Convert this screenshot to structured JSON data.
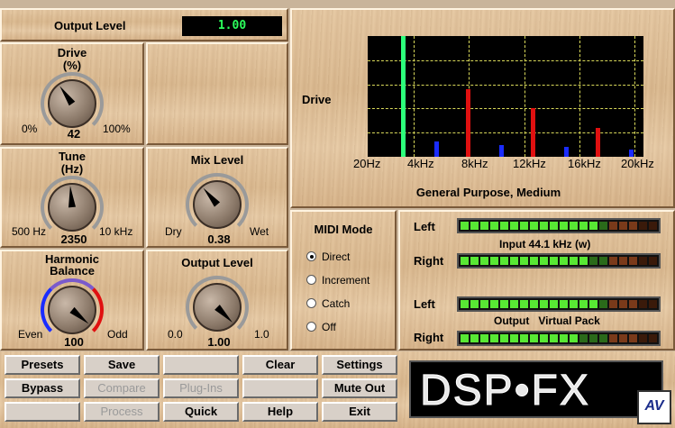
{
  "header": {
    "output_level_label": "Output Level",
    "output_level_value": "1.00"
  },
  "knobs": {
    "drive": {
      "title": "Drive",
      "unit": "(%)",
      "min": "0%",
      "max": "100%",
      "value": "42"
    },
    "tune": {
      "title": "Tune",
      "unit": "(Hz)",
      "min": "500 Hz",
      "max": "10 kHz",
      "value": "2350"
    },
    "mix": {
      "title": "Mix Level",
      "min": "Dry",
      "max": "Wet",
      "value": "0.38"
    },
    "harmonic": {
      "title": "Harmonic",
      "title2": "Balance",
      "min": "Even",
      "max": "Odd",
      "value": "100"
    },
    "output": {
      "title": "Output Level",
      "min": "0.0",
      "max": "1.0",
      "value": "1.00"
    }
  },
  "graph": {
    "ylabel": "Drive",
    "x_ticks": [
      "20Hz",
      "4kHz",
      "8kHz",
      "12kHz",
      "16kHz",
      "20kHz"
    ],
    "caption": "General Purpose, Medium"
  },
  "chart_data": {
    "type": "bar",
    "ylabel": "Drive",
    "xlim": [
      "20Hz",
      "20kHz"
    ],
    "series": [
      {
        "color": "#2cff7a",
        "x_khz": [
          2.3
        ],
        "values": [
          1.0
        ]
      },
      {
        "color": "#e01010",
        "x_khz": [
          7.0,
          11.7,
          16.4
        ],
        "values": [
          0.56,
          0.4,
          0.24
        ]
      },
      {
        "color": "#1a2cff",
        "x_khz": [
          4.7,
          9.4,
          14.1,
          18.8
        ],
        "values": [
          0.13,
          0.1,
          0.08,
          0.06
        ]
      }
    ]
  },
  "midi": {
    "title": "MIDI Mode",
    "options": [
      "Direct",
      "Increment",
      "Catch",
      "Off"
    ],
    "selected": "Direct"
  },
  "meters": {
    "left": "Left",
    "right": "Right",
    "input_caption": "Input  44.1 kHz  (w)",
    "output_caption": "Output   Virtual Pack",
    "in_left_level": 0.7,
    "in_right_level": 0.62,
    "out_left_level": 0.7,
    "out_right_level": 0.58
  },
  "buttons": {
    "row1": [
      "Presets",
      "Save",
      "",
      "Clear",
      "Settings"
    ],
    "row2": [
      "Bypass",
      "Compare",
      "Plug-Ins",
      "",
      "Mute Out"
    ],
    "row3": [
      "",
      "Process",
      "Quick",
      "Help",
      "Exit"
    ]
  },
  "logo": {
    "text": "DSP•FX",
    "badge": "AV"
  },
  "colors": {
    "lcd_text": "#2cff5c",
    "meter_green": "#58e834",
    "meter_dark": "#7a3a1a",
    "meter_dim": "#3a1a0a"
  }
}
